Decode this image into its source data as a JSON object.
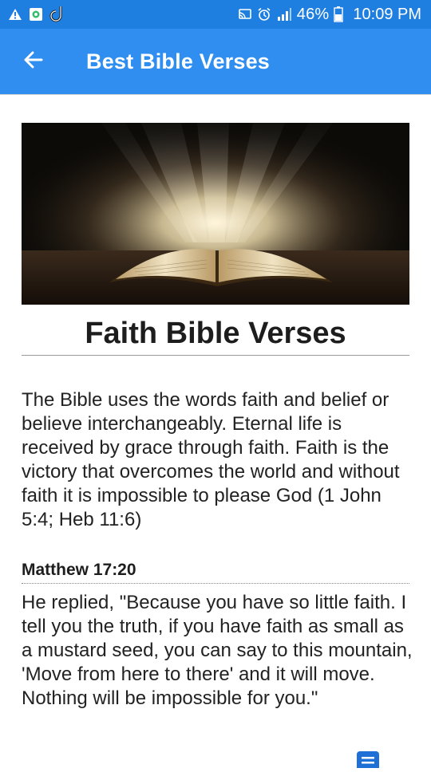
{
  "status_bar": {
    "battery": "46%",
    "time": "10:09 PM",
    "icons": [
      "warning-icon",
      "app-icon",
      "sync-icon",
      "cast-icon",
      "alarm-icon",
      "signal-icon",
      "battery-icon"
    ]
  },
  "app_bar": {
    "title": "Best Bible Verses",
    "back_icon": "arrow-left-icon"
  },
  "page": {
    "title": "Faith Bible Verses",
    "intro": "The Bible uses the words faith and belief or believe interchangeably. Eternal life is received by grace through faith. Faith is the victory that overcomes the world and without faith it is impossible to please God (1 John 5:4; Heb 11:6)"
  },
  "verse": {
    "reference": "Matthew 17:20",
    "text": "He replied, \"Because you have so little faith. I tell you the truth, if you have faith as small as a mustard seed, you can say to this mountain, 'Move from here to there' and it will move. Nothing will be impossible for you.\""
  },
  "colors": {
    "status_bar": "#1e7fe0",
    "app_bar": "#2f8ef0",
    "accent": "#1e6fd6"
  }
}
